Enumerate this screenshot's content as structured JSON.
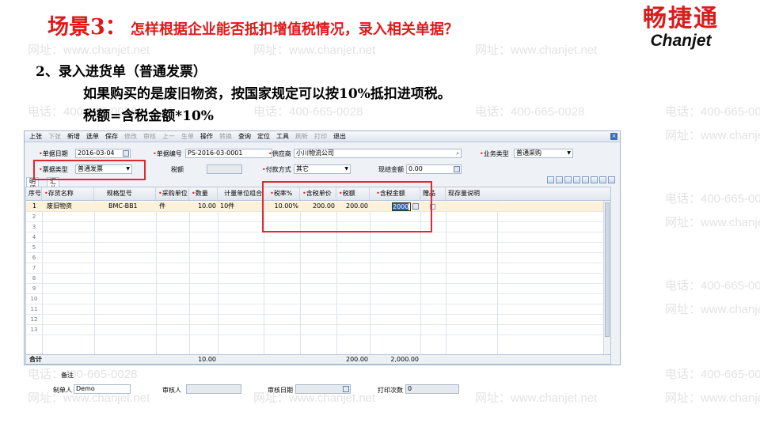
{
  "slide": {
    "title_part1": "场景3：",
    "title_part2": "怎样根据企业能否抵扣增值税情况，录入相关单据？",
    "heading": "2、录入进货单（普通发票）",
    "note_line1": "如果购买的是废旧物资，按国家规定可以按10%抵扣进项税。",
    "note_line2": "税额=含税金额*10%",
    "logo_cn": "畅捷通",
    "logo_en": "Chanjet",
    "watermark_phone": "电话：400-665-0028",
    "watermark_web": "网址：www.chanjet.net"
  },
  "toolbar": {
    "items": [
      "上张",
      "下张",
      "新增",
      "选单",
      "保存",
      "修改",
      "审核",
      "上一",
      "生单",
      "操作",
      "转换",
      "查询",
      "定位",
      "工具",
      "刷新",
      "打印",
      "退出"
    ]
  },
  "form": {
    "doc_date_label": "单据日期",
    "doc_date_value": "2016-03-04",
    "doc_no_label": "单据编号",
    "doc_no_value": "PS-2016-03-0001",
    "supplier_label": "供应商",
    "supplier_value": "小川物流公司",
    "biz_type_label": "业务类型",
    "biz_type_value": "普通采购",
    "invoice_type_label": "票据类型",
    "invoice_type_value": "普通发票",
    "tax_reg_label": "税额",
    "payment_label": "付款方式",
    "payment_value": "其它",
    "settle_amount_label": "现结金额",
    "settle_amount_value": "0.00"
  },
  "tabs": [
    "明细",
    "汇总"
  ],
  "grid": {
    "headers": [
      "序号",
      "存货名称",
      "规格型号",
      "采购单位",
      "数量",
      "计量单位组合",
      "税率%",
      "含税单价",
      "税额",
      "含税金额",
      "赠品",
      "现存量说明"
    ],
    "rows": [
      {
        "no": "1",
        "name": "废旧物资",
        "spec": "BMC-BB1",
        "unit": "件",
        "qty": "10.00",
        "unit_group": "10件",
        "tax_rate": "10.00%",
        "unit_price": "200.00",
        "tax": "200.00",
        "amount": "2000"
      }
    ],
    "row_numbers": [
      "1",
      "2",
      "3",
      "4",
      "5",
      "6",
      "7",
      "8",
      "9",
      "10",
      "11",
      "12",
      "13"
    ],
    "total_label": "合计",
    "total_qty": "10.00",
    "total_tax": "200.00",
    "total_amount": "2,000.00"
  },
  "footer": {
    "remark_label": "备注",
    "maker_label": "制单人",
    "maker_value": "Demo",
    "auditor_label": "审核人",
    "audit_date_label": "审核日期",
    "print_count_label": "打印次数",
    "print_count_value": "0"
  },
  "colors": {
    "title_red": "#e01818",
    "highlight_red": "#e0282e",
    "selected_row": "#fdf1da"
  }
}
